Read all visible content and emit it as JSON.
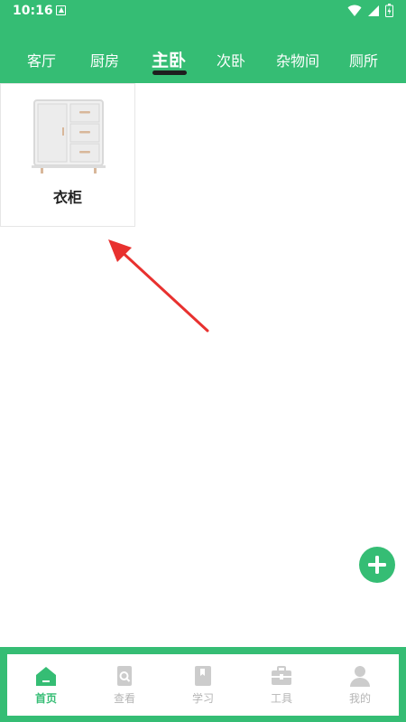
{
  "status_bar": {
    "time": "10:16"
  },
  "tabs": [
    {
      "label": "客厅"
    },
    {
      "label": "厨房"
    },
    {
      "label": "主卧"
    },
    {
      "label": "次卧"
    },
    {
      "label": "杂物间"
    },
    {
      "label": "厕所"
    }
  ],
  "active_tab": "主卧",
  "items": [
    {
      "label": "衣柜"
    }
  ],
  "bottom_nav": [
    {
      "label": "首页",
      "icon": "home-icon"
    },
    {
      "label": "查看",
      "icon": "view-doc-icon"
    },
    {
      "label": "学习",
      "icon": "book-icon"
    },
    {
      "label": "工具",
      "icon": "toolbox-icon"
    },
    {
      "label": "我的",
      "icon": "user-icon"
    }
  ],
  "colors": {
    "brand_green": "#35bd74",
    "inactive_gray": "#b5b5b5",
    "annotation_red": "#e8312f"
  }
}
